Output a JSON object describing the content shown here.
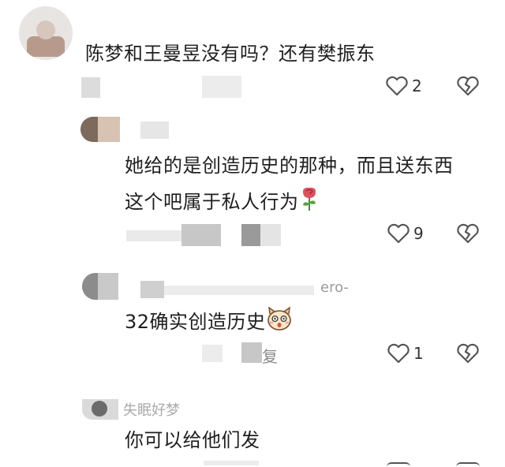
{
  "comments": [
    {
      "text": "陈梦和王曼昱没有吗？还有樊振东",
      "likes": "2"
    },
    {
      "text_line1": "她给的是创造历史的那种，而且送东西",
      "text_line2": "这个吧属于私人行为",
      "likes": "9"
    },
    {
      "username_suffix": "ero-",
      "text": "32确实创造历史",
      "likes": "1",
      "reply_fragment": "复"
    },
    {
      "username": "失眠好梦",
      "text": "你可以给他们发"
    }
  ],
  "icons": {
    "like": "heart-outline-icon",
    "dislike": "broken-heart-icon",
    "rose": "rose-emoji",
    "face": "shocked-face-emoji"
  }
}
